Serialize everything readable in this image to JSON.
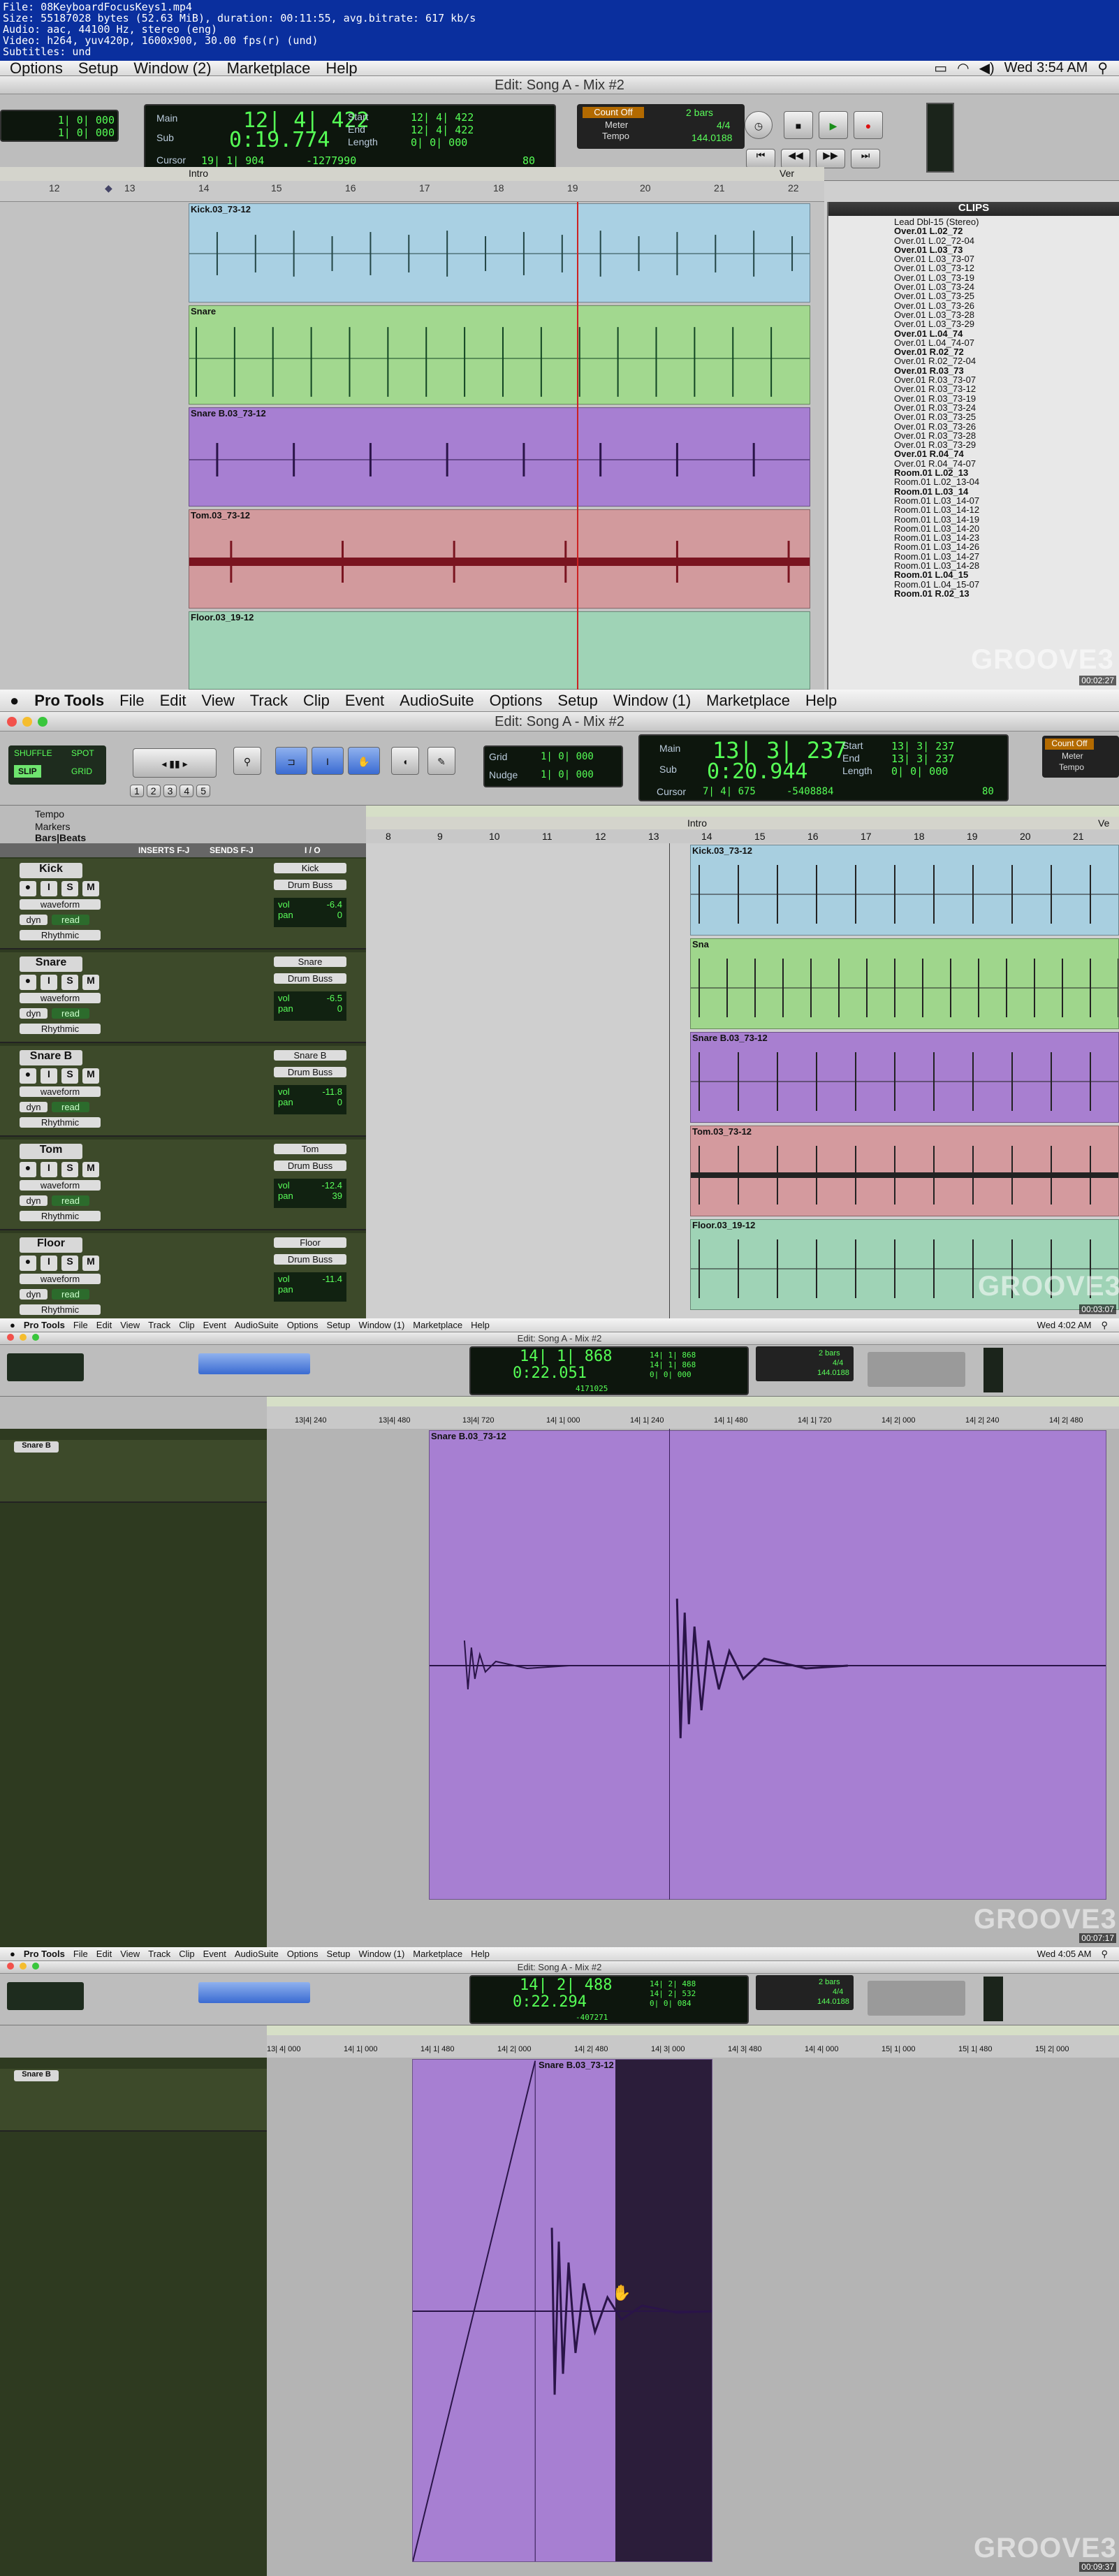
{
  "file_header": {
    "file": "File: 08KeyboardFocusKeys1.mp4",
    "size": "Size: 55187028 bytes (52.63 MiB), duration: 00:11:55, avg.bitrate: 617 kb/s",
    "audio": "Audio: aac, 44100 Hz, stereo (eng)",
    "video": "Video: h264, yuv420p, 1600x900, 30.00 fps(r) (und)",
    "subtitles": "Subtitles: und"
  },
  "frame1": {
    "menus": [
      "Options",
      "Setup",
      "Window (2)",
      "Marketplace",
      "Help"
    ],
    "clock": "Wed 3:54 AM",
    "title": "Edit: Song A - Mix #2",
    "main_label": "Main",
    "main": "12| 4| 422",
    "sub_label": "Sub",
    "sub": "0:19.774",
    "start_label": "Start",
    "start": "12| 4| 422",
    "end_label": "End",
    "end": "12| 4| 422",
    "length_label": "Length",
    "length": "0| 0| 000",
    "cursor_label": "Cursor",
    "cursor": "19| 1| 904",
    "cursor_val": "-1277990",
    "left_a": "1| 0| 000",
    "left_b": "1| 0| 000",
    "count_off": "Count Off",
    "meter": "Meter",
    "tempo": "Tempo",
    "bars": "2 bars",
    "sig": "4/4",
    "bpm": "144.0188",
    "eighty": "80",
    "ruler": [
      "12",
      "13",
      "14",
      "15",
      "16",
      "17",
      "18",
      "19",
      "20",
      "21",
      "22"
    ],
    "marker_intro": "Intro",
    "marker_ve": "Ver",
    "clips": [
      "Kick.03_73-12",
      "Snare",
      "Snare B.03_73-12",
      "Tom.03_73-12",
      "Floor.03_19-12"
    ],
    "clip_panel_title": "CLIPS",
    "clip_list": [
      "Lead Dbl-15 (Stereo)",
      "Over.01 L.02_72",
      "Over.01 L.02_72-04",
      "Over.01 L.03_73",
      "Over.01 L.03_73-07",
      "Over.01 L.03_73-12",
      "Over.01 L.03_73-19",
      "Over.01 L.03_73-24",
      "Over.01 L.03_73-25",
      "Over.01 L.03_73-26",
      "Over.01 L.03_73-28",
      "Over.01 L.03_73-29",
      "Over.01 L.04_74",
      "Over.01 L.04_74-07",
      "Over.01 R.02_72",
      "Over.01 R.02_72-04",
      "Over.01 R.03_73",
      "Over.01 R.03_73-07",
      "Over.01 R.03_73-12",
      "Over.01 R.03_73-19",
      "Over.01 R.03_73-24",
      "Over.01 R.03_73-25",
      "Over.01 R.03_73-26",
      "Over.01 R.03_73-28",
      "Over.01 R.03_73-29",
      "Over.01 R.04_74",
      "Over.01 R.04_74-07",
      "Room.01 L.02_13",
      "Room.01 L.02_13-04",
      "Room.01 L.03_14",
      "Room.01 L.03_14-07",
      "Room.01 L.03_14-12",
      "Room.01 L.03_14-19",
      "Room.01 L.03_14-20",
      "Room.01 L.03_14-23",
      "Room.01 L.03_14-26",
      "Room.01 L.03_14-27",
      "Room.01 L.03_14-28",
      "Room.01 L.04_15",
      "Room.01 L.04_15-07",
      "Room.01 R.02_13"
    ],
    "watermark": "GROOVE3",
    "timestamp": "00:02:27"
  },
  "frame2": {
    "menus": [
      "Pro Tools",
      "File",
      "Edit",
      "View",
      "Track",
      "Clip",
      "Event",
      "AudioSuite",
      "Options",
      "Setup",
      "Window (1)",
      "Marketplace",
      "Help"
    ],
    "title": "Edit: Song A - Mix #2",
    "shuffle": "SHUFFLE",
    "spot": "SPOT",
    "slip": "SLIP",
    "grid": "GRID",
    "grid_label": "Grid",
    "grid_val": "1| 0| 000",
    "nudge_label": "Nudge",
    "nudge_val": "1| 0| 000",
    "main_label": "Main",
    "main": "13| 3| 237",
    "sub_label": "Sub",
    "sub": "0:20.944",
    "start_label": "Start",
    "start": "13| 3| 237",
    "end_label": "End",
    "end": "13| 3| 237",
    "length_label": "Length",
    "length": "0| 0| 000",
    "cursor_label": "Cursor",
    "cursor": "7| 4| 675",
    "cursor_val": "-5408884",
    "eighty": "80",
    "count_off": "Count Off",
    "meter": "Meter",
    "tempo": "Tempo",
    "zoom_presets": [
      "1",
      "2",
      "3",
      "4",
      "5"
    ],
    "rows": [
      "Tempo",
      "Markers",
      "Bars|Beats"
    ],
    "headers": [
      "INSERTS F-J",
      "SENDS F-J",
      "I / O"
    ],
    "ruler": [
      "8",
      "9",
      "10",
      "11",
      "12",
      "13",
      "14",
      "15",
      "16",
      "17",
      "18",
      "19",
      "20",
      "21"
    ],
    "marker_intro": "Intro",
    "marker_ve": "Ve",
    "tracks": [
      {
        "name": "Kick",
        "bus": "Drum Buss",
        "vol": "-6.4",
        "pan": "0",
        "clip": "Kick.03_73-12",
        "color": "#a8cfe0"
      },
      {
        "name": "Snare",
        "bus": "Drum Buss",
        "vol": "-6.5",
        "pan": "0",
        "clip": "Sna",
        "color": "#9fd68c"
      },
      {
        "name": "Snare B",
        "bus": "Drum Buss",
        "vol": "-11.8",
        "pan": "0",
        "clip": "Snare B.03_73-12",
        "color": "#a87fd0"
      },
      {
        "name": "Tom",
        "bus": "Drum Buss",
        "vol": "-12.4",
        "pan": "39",
        "clip": "Tom.03_73-12",
        "color": "#d49a9e"
      },
      {
        "name": "Floor",
        "bus": "Drum Buss",
        "vol": "-11.4",
        "pan": "",
        "clip": "Floor.03_19-12",
        "color": "#9fd3b6"
      }
    ],
    "waveform": "waveform",
    "read": "read",
    "dyn": "dyn",
    "rhythmic": "Rhythmic",
    "vol_label": "vol",
    "pan_label": "pan",
    "watermark": "GROOVE3",
    "timestamp": "00:03:07"
  },
  "frame3": {
    "menus": [
      "Pro Tools",
      "File",
      "Edit",
      "View",
      "Track",
      "Clip",
      "Event",
      "AudioSuite",
      "Options",
      "Setup",
      "Window (1)",
      "Marketplace",
      "Help"
    ],
    "clock": "Wed 4:02 AM",
    "title": "Edit: Song A - Mix #2",
    "main": "14| 1| 868",
    "sub": "0:22.051",
    "start": "14| 1| 868",
    "end": "14| 1| 868",
    "length": "0| 0| 000",
    "cursor_val": "4171025",
    "bars": "2 bars",
    "sig": "4/4",
    "bpm": "144.0188",
    "ruler": [
      "13|4| 240",
      "13|4| 480",
      "13|4| 720",
      "14| 1| 000",
      "14| 1| 240",
      "14| 1| 480",
      "14| 1| 720",
      "14| 2| 000",
      "14| 2| 240",
      "14| 2| 480"
    ],
    "clip": "Snare B.03_73-12",
    "track": "Snare B",
    "watermark": "GROOVE3",
    "timestamp": "00:07:17"
  },
  "frame4": {
    "menus": [
      "Pro Tools",
      "File",
      "Edit",
      "View",
      "Track",
      "Clip",
      "Event",
      "AudioSuite",
      "Options",
      "Setup",
      "Window (1)",
      "Marketplace",
      "Help"
    ],
    "clock": "Wed 4:05 AM",
    "title": "Edit: Song A - Mix #2",
    "main": "14| 2| 488",
    "sub": "0:22.294",
    "start": "14| 2| 488",
    "end": "14| 2| 532",
    "length": "0| 0| 084",
    "cursor_val": "-407271",
    "bars": "2 bars",
    "sig": "4/4",
    "bpm": "144.0188",
    "ruler": [
      "13| 4| 000",
      "14| 1| 000",
      "14| 1| 480",
      "14| 2| 000",
      "14| 2| 480",
      "14| 3| 000",
      "14| 3| 480",
      "14| 4| 000",
      "15| 1| 000",
      "15| 1| 480",
      "15| 2| 000"
    ],
    "clip": "Snare B.03_73-12",
    "track": "Snare B",
    "watermark": "GROOVE3",
    "timestamp": "00:09:37"
  },
  "colors": {
    "kick": "#a9d0e3",
    "snare": "#a2d88f",
    "snareb": "#a77fd2",
    "tom": "#d29a9d",
    "floor": "#9fd3b6",
    "counter": "#56ff56"
  }
}
